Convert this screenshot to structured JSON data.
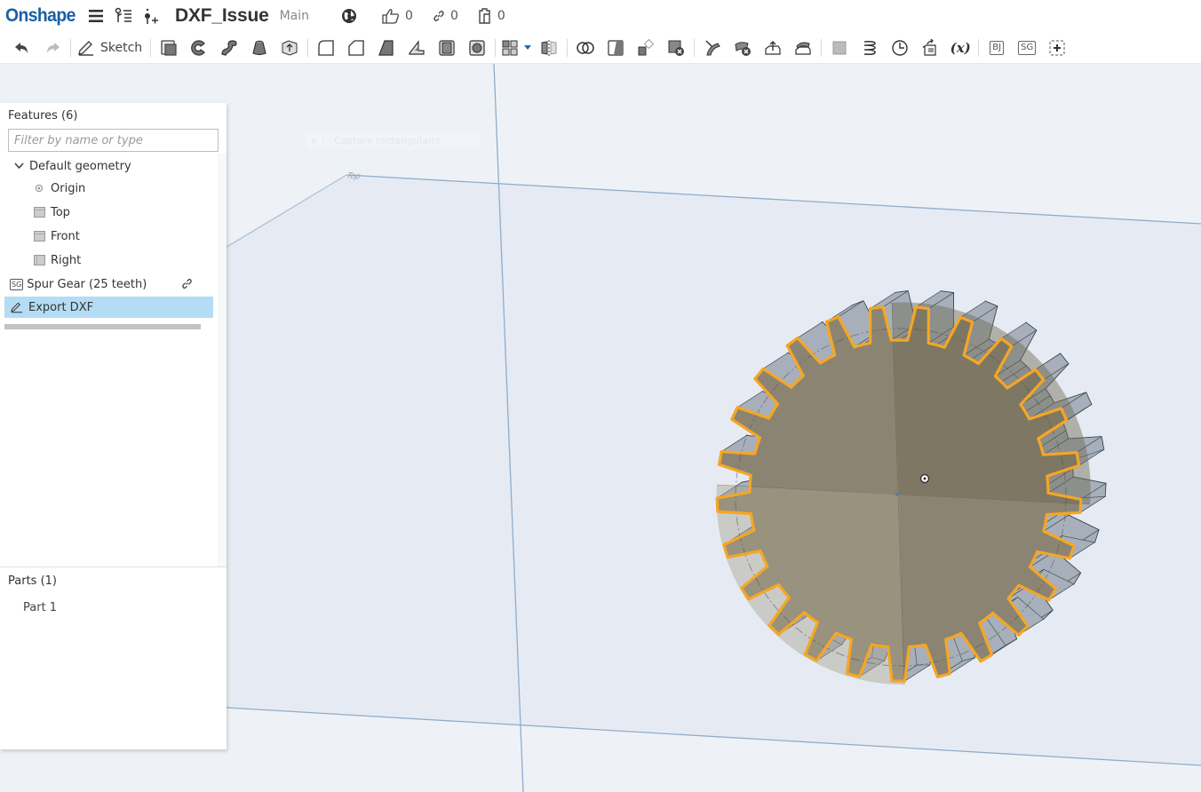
{
  "header": {
    "logo": "Onshape",
    "document_title": "DXF_Issue",
    "branch": "Main",
    "likes": "0",
    "links": "0",
    "copies": "0",
    "icons": [
      "menu-icon",
      "version-history-icon",
      "insert-icon",
      "globe-icon",
      "thumbs-up-icon",
      "link-icon",
      "clipboard-icon"
    ]
  },
  "toolbar": {
    "sketch_label": "Sketch",
    "tools": [
      "undo",
      "redo",
      "sketch",
      "extrude",
      "revolve",
      "sweep",
      "loft",
      "thicken",
      "fillet",
      "chamfer",
      "draft",
      "rib",
      "shell",
      "hole",
      "linear-pattern",
      "mirror",
      "boolean",
      "split",
      "transform",
      "delete-part",
      "modify-fillet",
      "delete-face",
      "move-face",
      "replace-face",
      "plane",
      "helix",
      "mate-connector",
      "derived",
      "variable",
      "BJ",
      "SG",
      "add-custom-feature"
    ],
    "custom_bj": "BJ",
    "custom_sg": "SG",
    "variable_label": "(x)"
  },
  "viewport": {
    "capture_hint": "Capture rectangulaire",
    "plane_label": "Top",
    "colors": {
      "background": "#eef2f7",
      "plane_fill": "#e5eaf2",
      "plane_edge": "#8eaecb",
      "gear_face": "#8b8472",
      "gear_side": "#9aa4ae",
      "selection": "#f5a623"
    },
    "gear_teeth": 25
  },
  "features_panel": {
    "title": "Features (6)",
    "filter_placeholder": "Filter by name or type",
    "items": [
      {
        "label": "Default geometry",
        "type": "group",
        "expanded": true
      },
      {
        "label": "Origin",
        "type": "origin"
      },
      {
        "label": "Top",
        "type": "plane"
      },
      {
        "label": "Front",
        "type": "plane"
      },
      {
        "label": "Right",
        "type": "plane"
      },
      {
        "label": "Spur Gear (25 teeth)",
        "type": "custom-feature",
        "badge": "SG",
        "linked": true
      },
      {
        "label": "Export DXF",
        "type": "sketch",
        "selected": true
      }
    ]
  },
  "parts_panel": {
    "title": "Parts (1)",
    "items": [
      {
        "label": "Part 1"
      }
    ]
  }
}
